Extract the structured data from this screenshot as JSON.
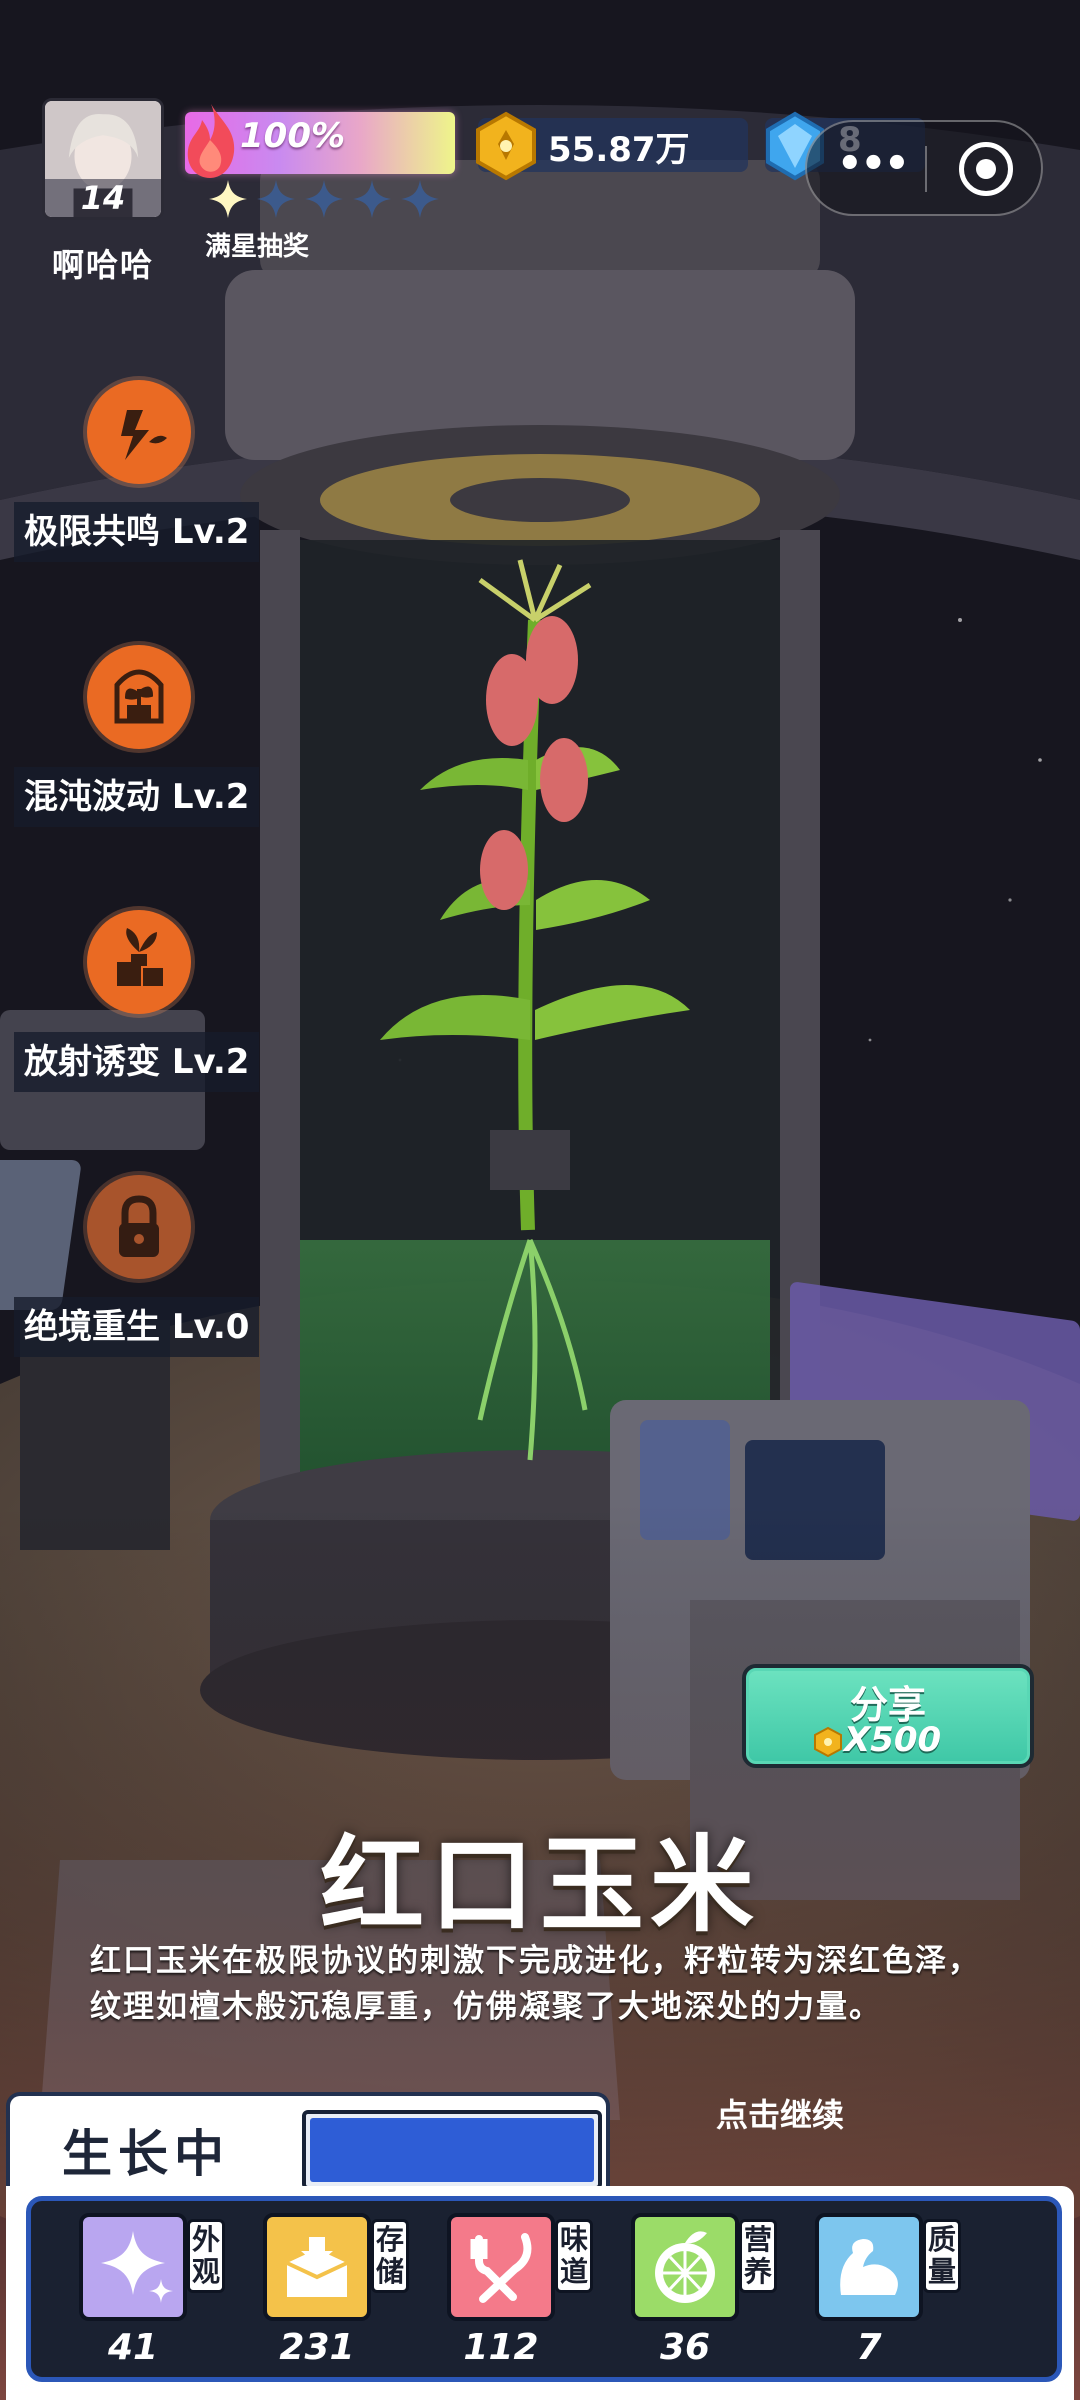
{
  "player": {
    "level": "14",
    "name": "啊哈哈"
  },
  "energy": {
    "percent_text": "100%",
    "fill_fraction": 1.0,
    "stars_filled": 1,
    "stars_total": 5,
    "stars_label": "满星抽奖"
  },
  "currency": {
    "coins": "55.87万",
    "gems": "8"
  },
  "skills": [
    {
      "label": "极限共鸣 Lv.2",
      "icon": "lightning-sprout-icon",
      "locked": false
    },
    {
      "label": "混沌波动 Lv.2",
      "icon": "potted-plant-icon",
      "locked": false
    },
    {
      "label": "放射诱变 Lv.2",
      "icon": "plant-boxes-icon",
      "locked": false
    },
    {
      "label": "绝境重生 Lv.0",
      "icon": "lock-icon",
      "locked": true
    }
  ],
  "share": {
    "label": "分享",
    "cost": "X500"
  },
  "plant": {
    "name": "红口玉米",
    "description": "红口玉米在极限协议的刺激下完成进化，籽粒转为深红色泽，纹理如檀木般沉稳厚重，仿佛凝聚了大地深处的力量。"
  },
  "continue_text": "点击继续",
  "status": {
    "label": "生长中",
    "progress_fraction": 1.0
  },
  "stats": [
    {
      "name": "外观",
      "value": "41",
      "icon": "sparkle-icon",
      "color": "#b9a6f0"
    },
    {
      "name": "存储",
      "value": "231",
      "icon": "box-icon",
      "color": "#f4c24a"
    },
    {
      "name": "味道",
      "value": "112",
      "icon": "fork-knife-icon",
      "color": "#f47a8a"
    },
    {
      "name": "营养",
      "value": "36",
      "icon": "lemon-icon",
      "color": "#9bdc68"
    },
    {
      "name": "质量",
      "value": "7",
      "icon": "muscle-icon",
      "color": "#7dc6ee"
    }
  ],
  "colors": {
    "skill_orange": "#ea6a23",
    "progress_blue": "#2e5dd6",
    "share_green": "#4fd0b0"
  }
}
